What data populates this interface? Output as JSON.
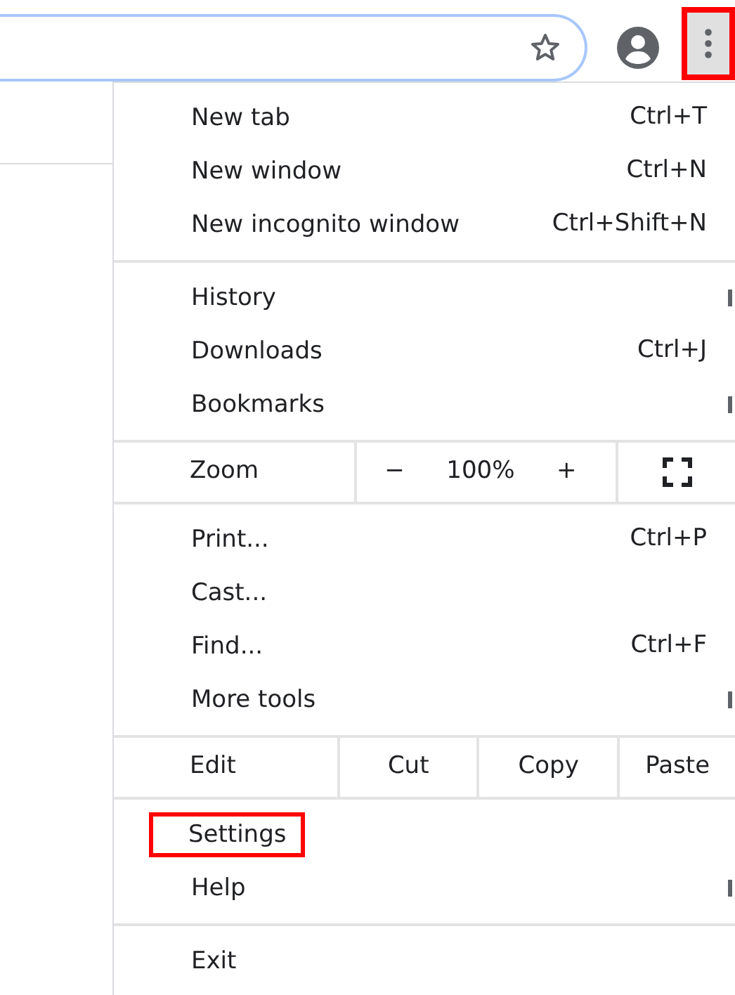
{
  "menu_button": {
    "highlighted": true
  },
  "menu": {
    "sections": [
      [
        {
          "kind": "item",
          "label": "New tab",
          "shortcut": "Ctrl+T",
          "submenu": false,
          "highlighted": false
        },
        {
          "kind": "item",
          "label": "New window",
          "shortcut": "Ctrl+N",
          "submenu": false,
          "highlighted": false
        },
        {
          "kind": "item",
          "label": "New incognito window",
          "shortcut": "Ctrl+Shift+N",
          "submenu": false,
          "highlighted": false
        }
      ],
      [
        {
          "kind": "item",
          "label": "History",
          "submenu": true,
          "highlighted": false
        },
        {
          "kind": "item",
          "label": "Downloads",
          "shortcut": "Ctrl+J",
          "submenu": false,
          "highlighted": false
        },
        {
          "kind": "item",
          "label": "Bookmarks",
          "submenu": true,
          "highlighted": false
        }
      ],
      [
        {
          "kind": "zoom",
          "label": "Zoom",
          "minus": "−",
          "value": "100%",
          "plus": "+"
        }
      ],
      [
        {
          "kind": "item",
          "label": "Print...",
          "shortcut": "Ctrl+P",
          "submenu": false,
          "highlighted": false
        },
        {
          "kind": "item",
          "label": "Cast...",
          "submenu": false,
          "highlighted": false
        },
        {
          "kind": "item",
          "label": "Find...",
          "shortcut": "Ctrl+F",
          "submenu": false,
          "highlighted": false
        },
        {
          "kind": "item",
          "label": "More tools",
          "submenu": true,
          "highlighted": false
        }
      ],
      [
        {
          "kind": "edit",
          "label": "Edit",
          "buttons": [
            "Cut",
            "Copy",
            "Paste"
          ]
        }
      ],
      [
        {
          "kind": "item",
          "label": "Settings",
          "submenu": false,
          "highlighted": true
        },
        {
          "kind": "item",
          "label": "Help",
          "submenu": true,
          "highlighted": false
        }
      ],
      [
        {
          "kind": "item",
          "label": "Exit",
          "submenu": false,
          "highlighted": false
        }
      ]
    ]
  }
}
